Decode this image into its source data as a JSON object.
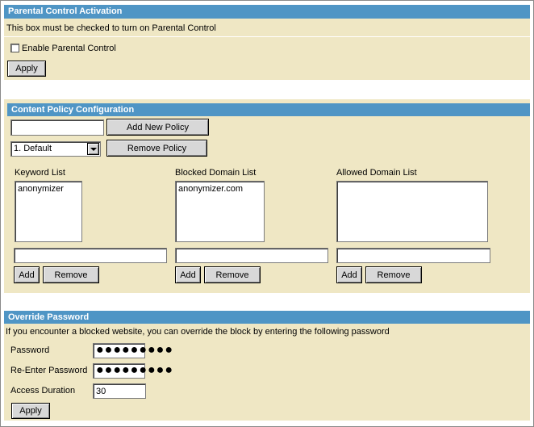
{
  "activation": {
    "title": "Parental Control Activation",
    "note": "This box must be checked to turn on Parental Control",
    "enable_label": "Enable Parental Control",
    "enable_checked": false,
    "apply_label": "Apply"
  },
  "content_policy": {
    "title": "Content Policy Configuration",
    "new_policy_value": "",
    "add_policy_label": "Add New Policy",
    "policy_selected": "1. Default",
    "remove_policy_label": "Remove Policy",
    "keyword": {
      "label": "Keyword List",
      "items": [
        "anonymizer"
      ],
      "input_value": "",
      "add_label": "Add",
      "remove_label": "Remove"
    },
    "blocked": {
      "label": "Blocked Domain List",
      "items": [
        "anonymizer.com"
      ],
      "input_value": "",
      "add_label": "Add",
      "remove_label": "Remove"
    },
    "allowed": {
      "label": "Allowed Domain List",
      "items": [],
      "input_value": "",
      "add_label": "Add",
      "remove_label": "Remove"
    }
  },
  "override": {
    "title": "Override Password",
    "note": "If you encounter a blocked website, you can override the block by entering the following password",
    "password_label": "Password",
    "password_value": "●●●●●●●●●",
    "reenter_label": "Re-Enter Password",
    "reenter_value": "●●●●●●●●●",
    "duration_label": "Access Duration",
    "duration_value": "30",
    "apply_label": "Apply"
  },
  "colors": {
    "header_blue": "#4f95c5",
    "panel_tan": "#efe7c4"
  }
}
